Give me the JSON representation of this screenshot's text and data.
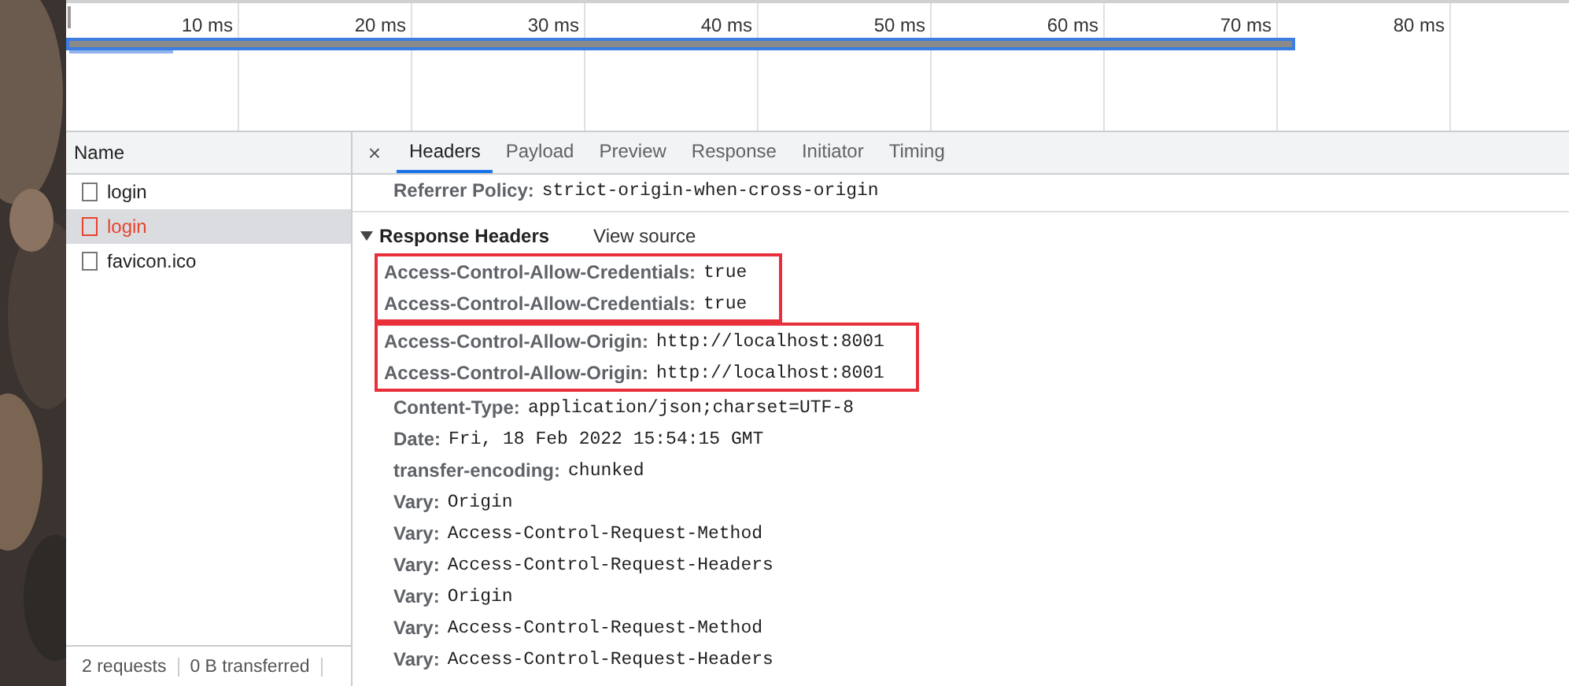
{
  "timeline": {
    "ticks": [
      "10 ms",
      "20 ms",
      "30 ms",
      "40 ms",
      "50 ms",
      "60 ms",
      "70 ms",
      "80 ms"
    ]
  },
  "requests": {
    "header": "Name",
    "items": [
      {
        "name": "login",
        "selected": false,
        "failed": false
      },
      {
        "name": "login",
        "selected": true,
        "failed": true
      },
      {
        "name": "favicon.ico",
        "selected": false,
        "failed": false
      }
    ],
    "status_bar": [
      "2 requests",
      "0 B transferred"
    ]
  },
  "details": {
    "close": "×",
    "tabs": [
      {
        "label": "Headers",
        "selected": true
      },
      {
        "label": "Payload",
        "selected": false
      },
      {
        "label": "Preview",
        "selected": false
      },
      {
        "label": "Response",
        "selected": false
      },
      {
        "label": "Initiator",
        "selected": false
      },
      {
        "label": "Timing",
        "selected": false
      }
    ],
    "referrer_policy": {
      "name": "Referrer Policy:",
      "value": "strict-origin-when-cross-origin"
    },
    "response_headers": {
      "title": "Response Headers",
      "expanded": true,
      "view_source": "View source",
      "groups": [
        {
          "highlighted": true,
          "rows": [
            {
              "name": "Access-Control-Allow-Credentials:",
              "value": "true"
            },
            {
              "name": "Access-Control-Allow-Credentials:",
              "value": "true"
            }
          ]
        },
        {
          "highlighted": true,
          "rows": [
            {
              "name": "Access-Control-Allow-Origin:",
              "value": "http://localhost:8001"
            },
            {
              "name": "Access-Control-Allow-Origin:",
              "value": "http://localhost:8001"
            }
          ]
        },
        {
          "highlighted": false,
          "rows": [
            {
              "name": "Content-Type:",
              "value": "application/json;charset=UTF-8"
            },
            {
              "name": "Date:",
              "value": "Fri, 18 Feb 2022 15:54:15 GMT"
            },
            {
              "name": "transfer-encoding:",
              "value": "chunked"
            },
            {
              "name": "Vary:",
              "value": "Origin"
            },
            {
              "name": "Vary:",
              "value": "Access-Control-Request-Method"
            },
            {
              "name": "Vary:",
              "value": "Access-Control-Request-Headers"
            },
            {
              "name": "Vary:",
              "value": "Origin"
            },
            {
              "name": "Vary:",
              "value": "Access-Control-Request-Method"
            },
            {
              "name": "Vary:",
              "value": "Access-Control-Request-Headers"
            }
          ]
        }
      ]
    }
  }
}
